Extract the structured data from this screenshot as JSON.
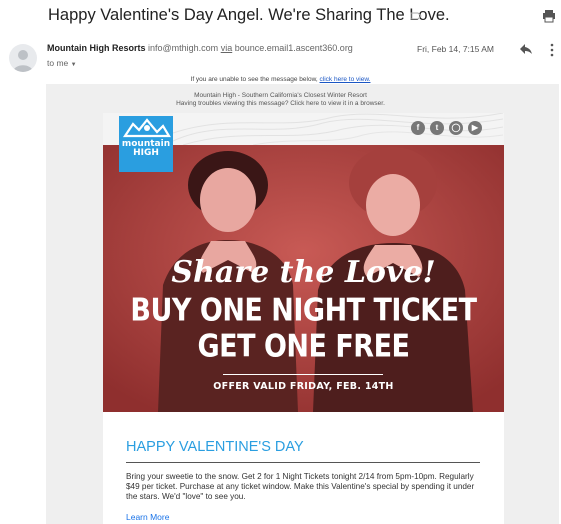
{
  "email": {
    "subject": "Happy Valentine's Day Angel. We're Sharing The Love.",
    "sender_name": "Mountain High Resorts",
    "sender_address": "info@mthigh.com",
    "via_label": "via",
    "via_domain": "bounce.email1.ascent360.org",
    "recipient": "to me",
    "date": "Fri, Feb 14, 7:15 AM"
  },
  "notices": {
    "unable_prefix": "If you are unable to see the message below,",
    "unable_link": "click here to view.",
    "resort_line": "Mountain High - Southern California's Closest Winter Resort",
    "trouble_line": "Having troubles viewing this message? Click here to view it in a browser."
  },
  "logo": {
    "line1": "mountain",
    "line2": "HIGH"
  },
  "hero": {
    "script": "Share the Love!",
    "line1": "BUY ONE NIGHT TICKET",
    "line2": "GET ONE FREE",
    "offer": "OFFER VALID FRIDAY, FEB. 14TH"
  },
  "content": {
    "title": "HAPPY VALENTINE'S DAY",
    "body": "Bring your sweetie to the snow. Get 2 for 1 Night Tickets tonight 2/14 from 5pm-10pm. Regularly $49 per ticket. Purchase at any ticket window. Make this Valentine's special by spending it under the stars. We'd \"love\" to see you.",
    "link": "Learn More"
  },
  "social": [
    "f",
    "t",
    "ig",
    "yt"
  ],
  "icons": {
    "label": "label-icon",
    "print": "print-icon",
    "reply": "reply-icon",
    "more": "more-vert-icon",
    "avatar": "person-icon",
    "recipient_toggle": "chevron-down-icon"
  },
  "colors": {
    "brand_blue": "#2a9ee0",
    "hero_red": "#b0413f",
    "link_blue": "#1a73e8"
  }
}
